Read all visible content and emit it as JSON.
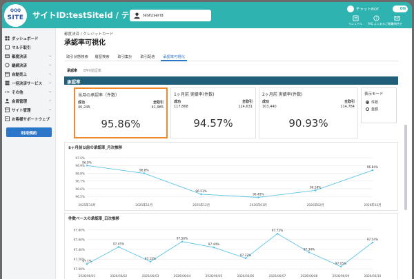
{
  "header": {
    "logo_top": "QQQ",
    "logo_bottom": "SITE",
    "site_title": "サイトID:testSiteId / テストサイト",
    "search": {
      "value": "testUserId",
      "placeholder": ""
    },
    "user": {
      "name": "チャットBOT",
      "toggle": "ON"
    },
    "icons": [
      {
        "name": "manual-icon",
        "label": "マニュアル"
      },
      {
        "name": "faq-icon",
        "label": "FAQ よくあるご質問"
      },
      {
        "name": "inquiry-icon",
        "label": "お問合せ"
      }
    ]
  },
  "sidebar": {
    "items": [
      {
        "label": "ダッシュボード",
        "icon": "dashboard-icon",
        "chevron": false
      },
      {
        "label": "マルチ取引",
        "icon": "multi-icon",
        "chevron": false
      },
      {
        "label": "都度決済",
        "icon": "card-icon",
        "chevron": true
      },
      {
        "label": "継続決済",
        "icon": "repeat-icon",
        "chevron": true
      },
      {
        "label": "自動売上",
        "icon": "calendar-icon",
        "chevron": true
      },
      {
        "label": "一括決済サービス",
        "icon": "batch-icon",
        "chevron": true
      },
      {
        "label": "その他",
        "icon": "more-icon",
        "chevron": true
      },
      {
        "label": "会員管理",
        "icon": "members-icon",
        "chevron": true
      },
      {
        "label": "サイト管理",
        "icon": "site-icon",
        "chevron": true
      },
      {
        "label": "お客様サポートウェブ",
        "icon": "support-icon",
        "chevron": false
      }
    ],
    "contract_button": "利用規約"
  },
  "main": {
    "breadcrumb": "都度決済 / クレジットカード",
    "title": "承認率可視化",
    "tabs": [
      "取引状態検索",
      "履歴検索",
      "取引集計",
      "取引配信",
      "承認率可視化"
    ],
    "active_tab": 4,
    "subtabs": [
      "承認率",
      "EMV認証率"
    ],
    "section_title": "承認率",
    "kpis": [
      {
        "title": "当月の承認率（件数）",
        "success_label": "成功",
        "total_label": "全取引",
        "success": "40,245",
        "total": "41,985",
        "rate": "95.86%"
      },
      {
        "title": "1ヶ月前 実績率(件数)",
        "success_label": "成功",
        "total_label": "全取引",
        "success": "117,868",
        "total": "124,631",
        "rate": "94.57%"
      },
      {
        "title": "2ヶ月前 実績率(件数)",
        "success_label": "成功",
        "total_label": "全取引",
        "success": "103,440",
        "total": "114,784",
        "rate": "90.93%"
      }
    ],
    "display_mode": {
      "title": "表示モード",
      "options": [
        "件数",
        "金額"
      ],
      "selected": 0
    },
    "charts": {
      "monthly_title": "$ヶ月前以前の承認率_月次推移",
      "daily_title": "件数ベースの承認率_日次推移"
    }
  },
  "chart_data": [
    {
      "type": "line",
      "title": "$ヶ月前以前の承認率_月次推移",
      "x": [
        "2025年10月",
        "2025年11月",
        "2025年12月",
        "2026年01月",
        "2026年02月",
        "2026年03月"
      ],
      "values": [
        96.9,
        96.8,
        96.53,
        96.49,
        96.58,
        96.84
      ],
      "data_labels": [
        "96.9%",
        "96.8%",
        "96.53%",
        "96.49%",
        "96.58%",
        "96.84%"
      ],
      "yticks": [
        "97.0%",
        "96.9%",
        "96.8%",
        "96.7%",
        "96.6%",
        "96.5%"
      ],
      "ylim": [
        96.45,
        97.0
      ],
      "color": "#5bc4e6",
      "grid": true
    },
    {
      "type": "line",
      "title": "件数ベースの承認率_日次推移",
      "x": [
        "2026/06/01",
        "2026/06/02",
        "2026/06/03",
        "2026/06/04",
        "2026/06/05",
        "2026/06/06",
        "2026/06/07",
        "2026/06/08",
        "2026/06/09",
        "2026/06/10"
      ],
      "values": [
        97.1,
        97.45,
        97.15,
        97.56,
        97.44,
        97.22,
        97.72,
        97.34,
        97.05,
        97.54
      ],
      "data_labels": [
        "97.1%",
        "97.45%",
        "97.15%",
        "97.56%",
        "97.44%",
        "97.22%",
        "97.72%",
        "97.34%",
        "97.05%",
        "97.54%"
      ],
      "yticks": [
        "97.80%",
        "97.60%",
        "97.40%",
        "97.20%",
        "97.00%"
      ],
      "ylim": [
        96.95,
        97.85
      ],
      "color": "#5bc4e6",
      "grid": true
    }
  ]
}
